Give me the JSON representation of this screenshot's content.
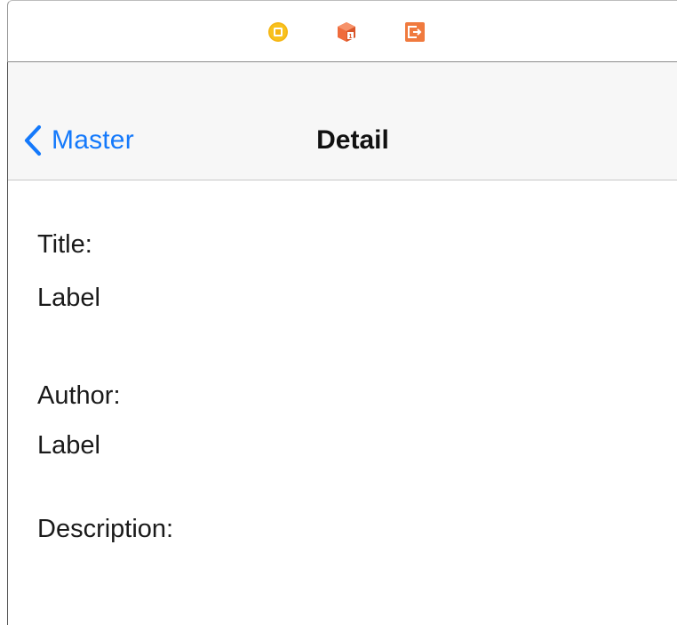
{
  "scene_dock": {
    "icons": [
      {
        "name": "view-controller-icon",
        "color": "#f5b614"
      },
      {
        "name": "first-responder-icon",
        "color": "#ef6b3c"
      },
      {
        "name": "exit-icon",
        "color": "#f07a3e"
      }
    ]
  },
  "nav_bar": {
    "back_label": "Master",
    "title": "Detail"
  },
  "content": {
    "title_heading": "Title:",
    "title_value": "Label",
    "author_heading": "Author:",
    "author_value": "Label",
    "description_heading": "Description:"
  },
  "colors": {
    "accent": "#1479fb",
    "nav_background": "#f7f7f7"
  }
}
